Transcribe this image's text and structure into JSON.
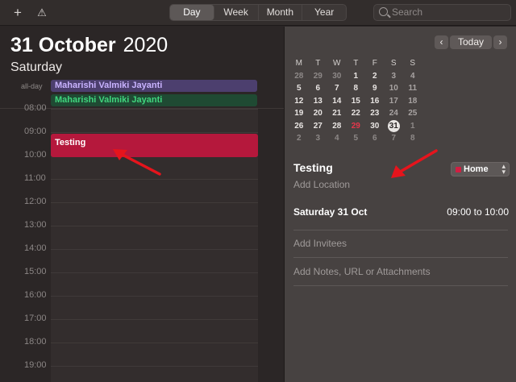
{
  "toolbar": {
    "add_glyph": "+",
    "alert_glyph": "⚠",
    "views": [
      {
        "label": "Day",
        "active": true
      },
      {
        "label": "Week",
        "active": false
      },
      {
        "label": "Month",
        "active": false
      },
      {
        "label": "Year",
        "active": false
      }
    ],
    "search_placeholder": "Search"
  },
  "day_view": {
    "date_bold": "31 October",
    "year": "2020",
    "weekday": "Saturday",
    "all_day_label": "all-day",
    "all_day_events": [
      {
        "title": "Maharishi Valmiki Jayanti",
        "color": "#c9b3ff"
      },
      {
        "title": "Maharishi Valmiki Jayanti",
        "color": "#40d67e"
      }
    ],
    "hours": [
      "08:00",
      "09:00",
      "10:00",
      "11:00",
      "12:00",
      "13:00",
      "14:00",
      "15:00",
      "16:00",
      "17:00",
      "18:00",
      "19:00"
    ],
    "event": {
      "title": "Testing",
      "color": "#b5183c"
    }
  },
  "mini_calendar": {
    "prev_label": "‹",
    "today_label": "Today",
    "next_label": "›",
    "weekdays": [
      "M",
      "T",
      "W",
      "T",
      "F",
      "S",
      "S"
    ],
    "weeks": [
      [
        "28",
        "29",
        "30",
        "1",
        "2",
        "3",
        "4"
      ],
      [
        "5",
        "6",
        "7",
        "8",
        "9",
        "10",
        "11"
      ],
      [
        "12",
        "13",
        "14",
        "15",
        "16",
        "17",
        "18"
      ],
      [
        "19",
        "20",
        "21",
        "22",
        "23",
        "24",
        "25"
      ],
      [
        "26",
        "27",
        "28",
        "29",
        "30",
        "31",
        "1"
      ],
      [
        "2",
        "3",
        "4",
        "5",
        "6",
        "7",
        "8"
      ]
    ],
    "selected": "31",
    "today": "29"
  },
  "inspector": {
    "title": "Testing",
    "calendar": "Home",
    "calendar_color": "#d21e42",
    "add_location": "Add Location",
    "date": "Saturday 31 Oct",
    "time": "09:00 to 10:00",
    "add_invitees": "Add Invitees",
    "add_notes": "Add Notes, URL or Attachments"
  }
}
